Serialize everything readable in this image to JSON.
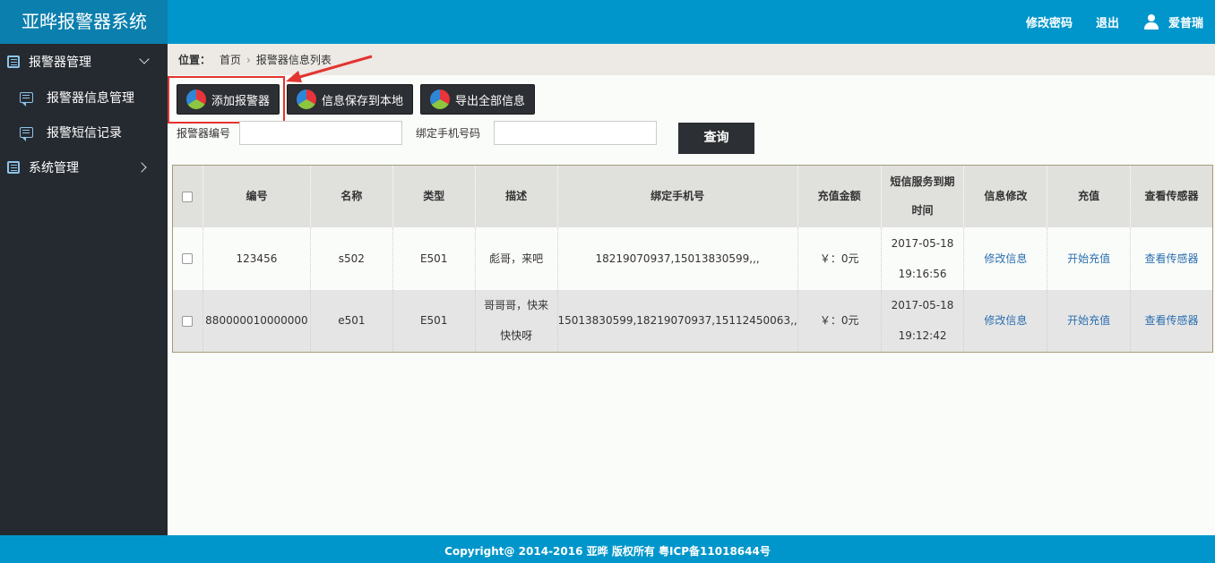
{
  "header": {
    "title": "亚晔报警器系统",
    "change_password": "修改密码",
    "logout": "退出",
    "username": "爱普瑞"
  },
  "sidebar": {
    "group1": "报警器管理",
    "items": [
      "报警器信息管理",
      "报警短信记录"
    ],
    "group2": "系统管理"
  },
  "breadcrumb": {
    "label": "位置：",
    "home": "首页",
    "current": "报警器信息列表"
  },
  "toolbar": {
    "add": "添加报警器",
    "save_local": "信息保存到本地",
    "export_all": "导出全部信息"
  },
  "search": {
    "field1_label": "报警器编号",
    "field1_value": "",
    "field2_label": "绑定手机号码",
    "field2_value": "",
    "query": "查询"
  },
  "table": {
    "headers": [
      "编号",
      "名称",
      "类型",
      "描述",
      "绑定手机号",
      "充值金额",
      "短信服务到期",
      "时间",
      "信息修改",
      "充值",
      "查看传感器"
    ],
    "rows": [
      {
        "id": "123456",
        "name": "s502",
        "type": "E501",
        "desc": "彪哥，来吧",
        "desc2": "",
        "phones": "18219070937,15013830599,,,",
        "amount": "￥：0元",
        "date": "2017-05-18",
        "time": "19:16:56",
        "edit": "修改信息",
        "recharge": "开始充值",
        "view": "查看传感器"
      },
      {
        "id": "880000010000000",
        "name": "e501",
        "type": "E501",
        "desc": "哥哥哥，快来",
        "desc2": "快快呀",
        "phones": "15013830599,18219070937,15112450063,,",
        "amount": "￥：0元",
        "date": "2017-05-18",
        "time": "19:12:42",
        "edit": "修改信息",
        "recharge": "开始充值",
        "view": "查看传感器"
      }
    ]
  },
  "footer": {
    "text": "Copyright@ 2014-2016 亚晔 版权所有 粤ICP备11018644号"
  },
  "colors": {
    "header_bg": "#0096cb",
    "brand_bg": "#0b7fae",
    "sidebar_bg": "#252a30",
    "highlight": "#e3342f",
    "link": "#2b6fb0"
  }
}
